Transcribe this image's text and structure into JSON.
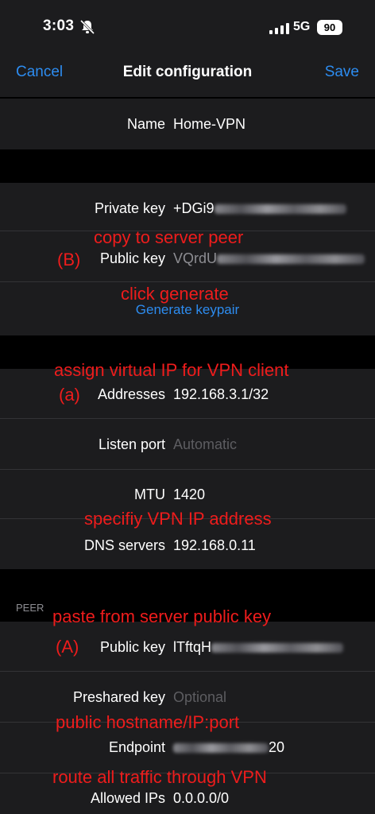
{
  "status_bar": {
    "time": "3:03",
    "network": "5G",
    "battery": "90"
  },
  "nav": {
    "cancel": "Cancel",
    "title": "Edit configuration",
    "save": "Save"
  },
  "interface": {
    "name_label": "Name",
    "name_value": "Home-VPN",
    "private_key_label": "Private key",
    "private_key_prefix": "+DGi9",
    "public_key_label": "Public key",
    "public_key_prefix": "VQrdU",
    "generate_label": "Generate keypair",
    "addresses_label": "Addresses",
    "addresses_value": "192.168.3.1/32",
    "listen_port_label": "Listen port",
    "listen_port_placeholder": "Automatic",
    "mtu_label": "MTU",
    "mtu_value": "1420",
    "dns_label": "DNS servers",
    "dns_value": "192.168.0.11"
  },
  "peer": {
    "header": "PEER",
    "public_key_label": "Public key",
    "public_key_prefix": "lTftqH",
    "preshared_label": "Preshared key",
    "preshared_placeholder": "Optional",
    "endpoint_label": "Endpoint",
    "endpoint_suffix": "20",
    "allowed_ips_label": "Allowed IPs",
    "allowed_ips_value": "0.0.0.0/0"
  },
  "annotations": {
    "copy_to_server": "copy to server peer",
    "marker_B": "(B)",
    "click_generate": "click generate",
    "assign_ip": "assign virtual IP for VPN client",
    "marker_a": "(a)",
    "specify_ip": "specifiy VPN IP address",
    "paste_key": "paste from server public key",
    "marker_A": "(A)",
    "hostname": "public hostname/IP:port",
    "route_all": "route all traffic through VPN"
  },
  "colors": {
    "accent": "#2d8cf0",
    "annotation": "#ee1c1c",
    "cell_bg": "#1c1c1e"
  }
}
